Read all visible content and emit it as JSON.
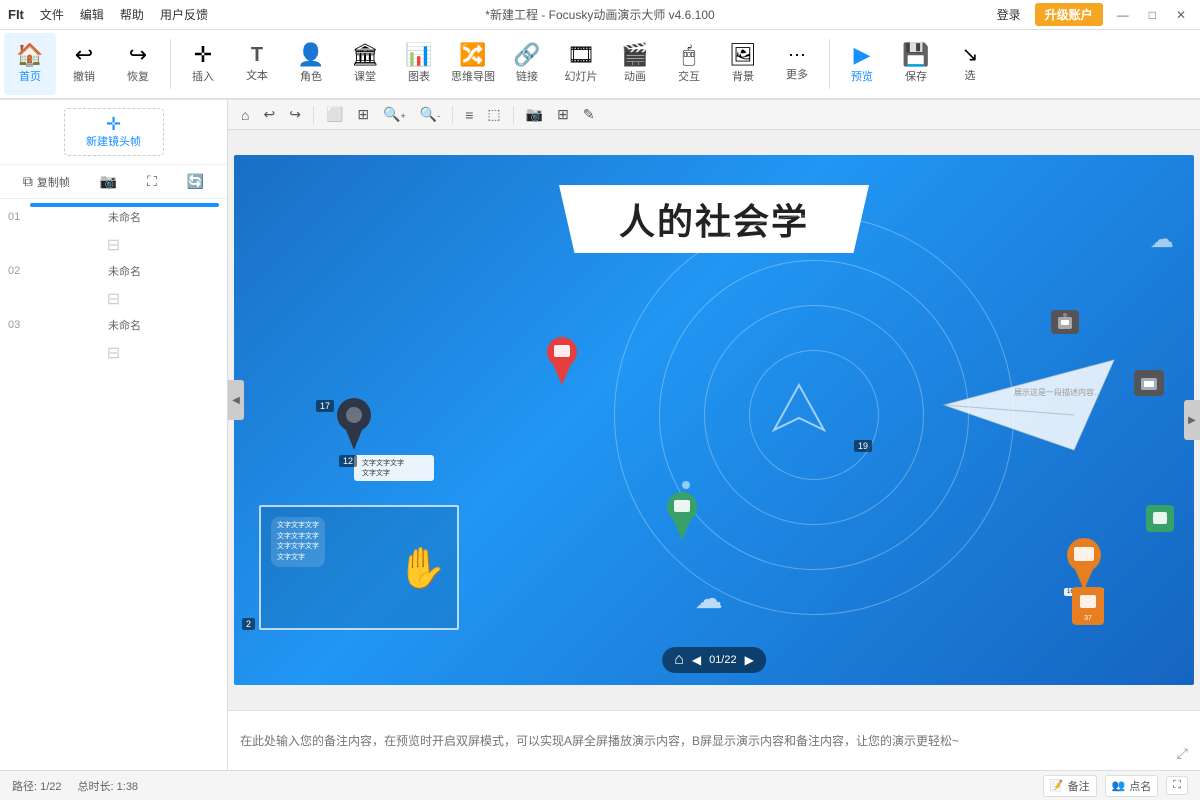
{
  "titlebar": {
    "logo": "FIt",
    "menu": [
      "文件",
      "编辑",
      "帮助",
      "用户反馈"
    ],
    "title": "*新建工程 - Focusky动画演示大师  v4.6.100",
    "login": "登录",
    "upgrade": "升级账户",
    "win_min": "—",
    "win_max": "□",
    "win_close": "✕"
  },
  "toolbar": {
    "items": [
      {
        "id": "home",
        "icon": "🏠",
        "label": "首页",
        "active": true
      },
      {
        "id": "undo",
        "icon": "↩",
        "label": "撤销"
      },
      {
        "id": "redo",
        "icon": "↪",
        "label": "恢复"
      },
      {
        "id": "insert",
        "icon": "✛",
        "label": "插入"
      },
      {
        "id": "text",
        "icon": "T",
        "label": "文本"
      },
      {
        "id": "role",
        "icon": "👤",
        "label": "角色"
      },
      {
        "id": "class",
        "icon": "🏛",
        "label": "课堂"
      },
      {
        "id": "chart",
        "icon": "📊",
        "label": "图表"
      },
      {
        "id": "mindmap",
        "icon": "🔀",
        "label": "思维导图"
      },
      {
        "id": "link",
        "icon": "🔗",
        "label": "链接"
      },
      {
        "id": "slide",
        "icon": "🎞",
        "label": "幻灯片"
      },
      {
        "id": "anim",
        "icon": "🎬",
        "label": "动画"
      },
      {
        "id": "interact",
        "icon": "🖱",
        "label": "交互"
      },
      {
        "id": "bg",
        "icon": "🖼",
        "label": "背景"
      },
      {
        "id": "more",
        "icon": "⋯",
        "label": "更多"
      },
      {
        "id": "preview",
        "icon": "▶",
        "label": "预览"
      },
      {
        "id": "save",
        "icon": "💾",
        "label": "保存"
      },
      {
        "id": "select",
        "icon": "↘",
        "label": "选"
      }
    ]
  },
  "canvas_toolbar": {
    "tools": [
      "⌂",
      "↩",
      "↩",
      "⬜",
      "⬜",
      "🔍+",
      "🔍-",
      "≡",
      "⬜",
      "📷",
      "⬜",
      "✎"
    ]
  },
  "slide_panel": {
    "new_frame_label": "新建镜头帧",
    "copy_label": "复制帧",
    "slides": [
      {
        "num": "01",
        "label": "未命名",
        "active": true,
        "bg": "#1a6fc4",
        "title": "人的社会学"
      },
      {
        "num": "02",
        "label": "未命名",
        "active": false,
        "bg": "#3949ab"
      },
      {
        "num": "03",
        "label": "未命名",
        "active": false,
        "bg": "#00897b"
      }
    ]
  },
  "canvas": {
    "main_title": "人的社会学",
    "frame_num": "2",
    "slide_info": "01/22",
    "arrow_label": "19"
  },
  "notes": {
    "placeholder": "在此处输入您的备注内容，在预览时开启双屏模式，可以实现A屏全屏播放演示内容，B屏显示演示内容和备注内容，让您的演示更轻松~"
  },
  "statusbar": {
    "path": "路径: 1/22",
    "duration": "总时长: 1:38",
    "notes_btn": "备注",
    "points_btn": "点名"
  }
}
